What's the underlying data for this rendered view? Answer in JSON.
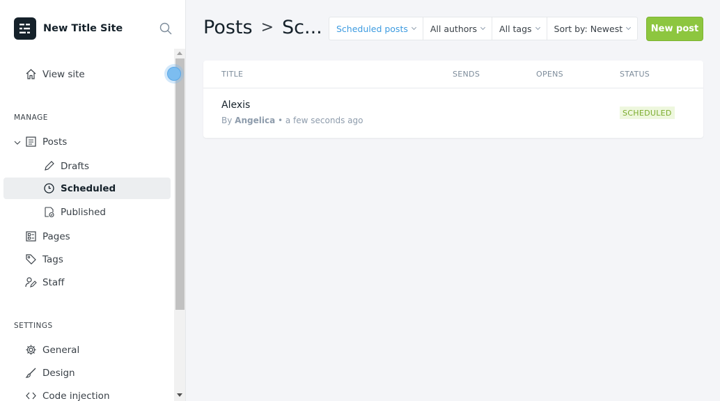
{
  "site": {
    "title": "New Title Site"
  },
  "sidebar": {
    "view_site": "View site",
    "manage_label": "MANAGE",
    "posts": "Posts",
    "drafts": "Drafts",
    "scheduled": "Scheduled",
    "published": "Published",
    "pages": "Pages",
    "tags": "Tags",
    "staff": "Staff",
    "settings_label": "SETTINGS",
    "general": "General",
    "design": "Design",
    "code_injection": "Code injection"
  },
  "header": {
    "title": "Posts",
    "separator": ">",
    "crumb": "Sc..."
  },
  "filters": {
    "type": "Scheduled posts",
    "authors": "All authors",
    "tags": "All tags",
    "sort": "Sort by: Newest"
  },
  "actions": {
    "new_post": "New post"
  },
  "table": {
    "columns": [
      "TITLE",
      "SENDS",
      "OPENS",
      "STATUS"
    ],
    "rows": [
      {
        "title": "Alexis",
        "by": "By",
        "author": "Angelica",
        "time": "• a few seconds ago",
        "status": "SCHEDULED"
      }
    ]
  },
  "colors": {
    "accent": "#8dc63f",
    "link": "#3d9be0",
    "status_scheduled": "#7aab2c"
  }
}
